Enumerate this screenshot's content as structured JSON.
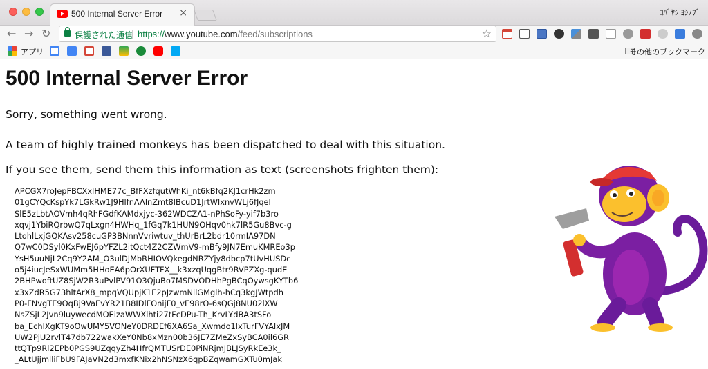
{
  "browser": {
    "tab_title": "500 Internal Server Error",
    "tab_close": "×",
    "profile_name": "ｺﾊﾞﾔｼ ﾖｼﾉﾌﾞ",
    "secure_label": "保護された通信",
    "url_scheme": "https://",
    "url_host": "www.youtube.com",
    "url_path": "/feed/subscriptions",
    "nav": {
      "back": "←",
      "forward": "→",
      "reload": "↻",
      "bookmark_star": "☆"
    },
    "bookmarks": {
      "apps_label": "アプリ",
      "other_label": "その他のブックマーク"
    },
    "colors": {
      "secure_green": "#0b8043",
      "youtube_red": "#ff0000"
    }
  },
  "page": {
    "heading": "500 Internal Server Error",
    "sorry": "Sorry, something went wrong.",
    "monkeys": "A team of highly trained monkeys has been dispatched to deal with this situation.",
    "instructions": "If you see them, send them this information as text (screenshots frighten them):",
    "error_lines": [
      "APCGX7roJepFBCXxlHME77c_BfFXzfqutWhKi_nt6kBfq2KJ1crHk2zm",
      "01gCYQcKspYk7LGkRw1J9HlfnAAlnZmt8lBcuD1JrtWlxnvWLj6fJqel",
      "SlE5zLbtAOVmh4qRhFGdfKAMdxjyc-362WDCZA1-nPhSoFy-yif7b3ro",
      "xqvj1YbiRQrbwQ7qLxgn4HWHq_1fGq7k1HUN9OHqv0hk7lR5Gu8Bvc-g",
      "LtohlLxjGQKAsv258cuGP3BNnnVvriwtuv_thUrBrL2bdr10rmIA97DN",
      "Q7wC0DSyl0KxFwEJ6pYFZL2itQct4Z2CZWmV9-mBfy9JN7EmuKMREo3p",
      "YsH5uuNjL2Cq9Y2AM_O3ulDJMbRHIOVQkegdNRZYjy8dbcp7tUvHUSDc",
      "o5j4iucJeSxWUMm5HHoEA6pOrXUFTFX__k3xzqUqgBtr9RVPZXg-qudE",
      "2BHPwoftUZ8SjW2R3uPvlPV91O3QjuBo7MSDVODHhPgBCqOywsgKYTb6",
      "x3xZdR5G73hltArX8_mpqVQUpjK1E2pJzwmNllGMglh-hCq3kgJWtpdh",
      "P0-FNvgTE9OqBj9VaEvYR21B8IDlFOnijF0_vE98rO-6sQGj8NU02lXW",
      "NsZSjL2Jvn9luywecdMOEizaWWXlhti27tFcDPu-Th_KrvLYdBA3tSFo",
      "ba_EchlXgKT9oOwUMY5VONeY0DRDEf6XA6Sa_Xwmdo1lxTurFVYAlxJM",
      "UW2PjU2rvlT47db722wakXeY0Nb8xMzn00b36JE7ZMeZxSyBCA0il6GR",
      "ttQTp9Rl2EPb0PGS9UZqqyZh4HfrQMTUSrDE0PiNRjmJBLJSyRkEe3k_",
      "_ALtUjjmlliFbU9FAJaVN2d3mxfKNix2hNSNzX6qpBZqwamGXTu0mJak"
    ]
  }
}
